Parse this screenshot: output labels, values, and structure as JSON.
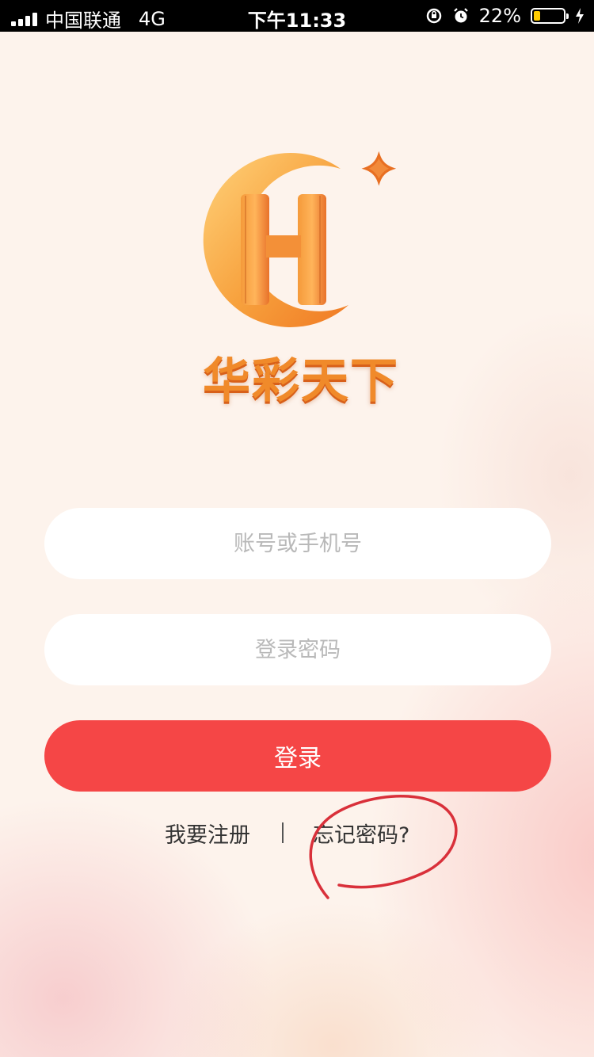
{
  "status_bar": {
    "carrier": "中国联通",
    "network": "4G",
    "time": "下午11:33",
    "battery_percent": "22%",
    "battery_level": 0.22,
    "icons": [
      "signal-icon",
      "orientation-lock-icon",
      "alarm-icon",
      "battery-icon",
      "charging-icon"
    ]
  },
  "brand": {
    "name": "华彩天下",
    "logo_letter": "H",
    "logo_badge": "+",
    "colors": {
      "orange": "#f08a2a",
      "gold": "#ffc75a"
    }
  },
  "form": {
    "account_placeholder": "账号或手机号",
    "password_placeholder": "登录密码",
    "login_label": "登录",
    "login_color": "#f54646"
  },
  "links": {
    "register": "我要注册",
    "separator": "|",
    "forgot_password": "忘记密码?"
  },
  "annotation": {
    "type": "hand-drawn circle",
    "color": "#d9303a"
  }
}
